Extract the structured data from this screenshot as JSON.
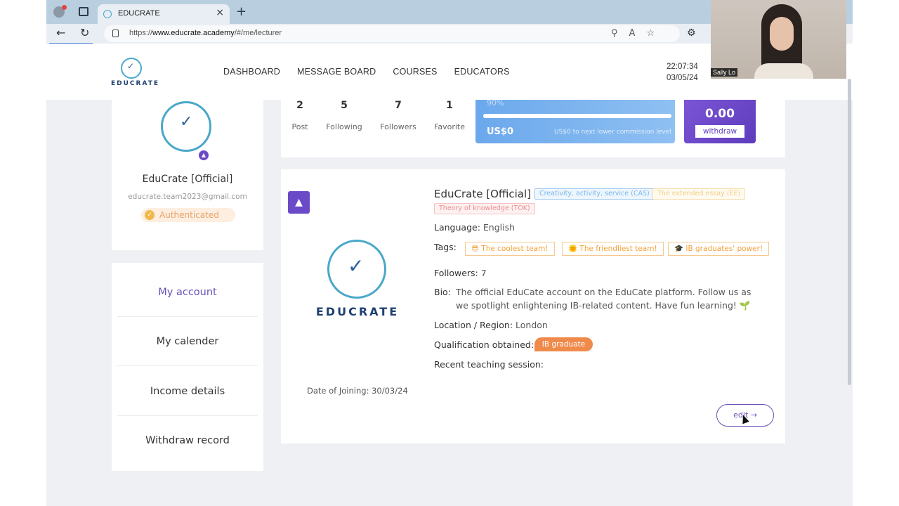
{
  "browser": {
    "tab_title": "EDUCRATE",
    "url_prefix": "https://",
    "url_domain": "www.educrate.academy",
    "url_path": "/#/me/lecturer"
  },
  "header": {
    "logo_text": "EDUCRATE",
    "nav": [
      "DASHBOARD",
      "MESSAGE BOARD",
      "COURSES",
      "EDUCATORS"
    ],
    "time": "22:07:34",
    "date": "03/05/24"
  },
  "webcam": {
    "name": "Sally Lo"
  },
  "profile": {
    "name": "EduCrate [Official]",
    "email": "educrate.team2023@gmail.com",
    "status": "Authenticated"
  },
  "sidebar": {
    "items": [
      {
        "label": "My account",
        "active": true
      },
      {
        "label": "My calender",
        "active": false
      },
      {
        "label": "Income details",
        "active": false
      },
      {
        "label": "Withdraw record",
        "active": false
      }
    ]
  },
  "stats": [
    {
      "value": "2",
      "label": "Post"
    },
    {
      "value": "5",
      "label": "Following"
    },
    {
      "value": "7",
      "label": "Followers"
    },
    {
      "value": "1",
      "label": "Favorite"
    }
  ],
  "commission": {
    "percent_label": "90%",
    "progress": 1.0,
    "amount": "US$0",
    "note": "US$0 to next lower commission level"
  },
  "balance": {
    "value": "0.00",
    "withdraw_label": "withdraw"
  },
  "details": {
    "logo_text": "EDUCRATE",
    "name": "EduCrate [Official]",
    "chips": [
      "Creativity, activity, service (CAS)",
      "The extended essay (EE)",
      "Theory of knowledge (TOK)"
    ],
    "language_label": "Language:",
    "language": "English",
    "tags_label": "Tags:",
    "tags": [
      "😎 The coolest team!",
      "🌞 The friendliest team!",
      "🎓 IB graduates' power!"
    ],
    "followers_label": "Followers:",
    "followers": "7",
    "bio_label": "Bio:",
    "bio": "The official EduCate account on the EduCate platform. Follow us as we spotlight enlightening IB-related content. Have fun learning! 🌱",
    "location_label": "Location / Region:",
    "location": "London",
    "qualification_label": "Qualification obtained:",
    "qualification": "IB graduate",
    "recent_label": "Recent teaching session:",
    "join_label": "Date of Joining:",
    "join_date": "30/03/24",
    "edit_label": "edit →"
  },
  "colors": {
    "accent": "#6a4fb7",
    "brand_blue": "#4aa8c9",
    "commission": "#6ba8ec",
    "tag_orange": "#f2a13b"
  }
}
